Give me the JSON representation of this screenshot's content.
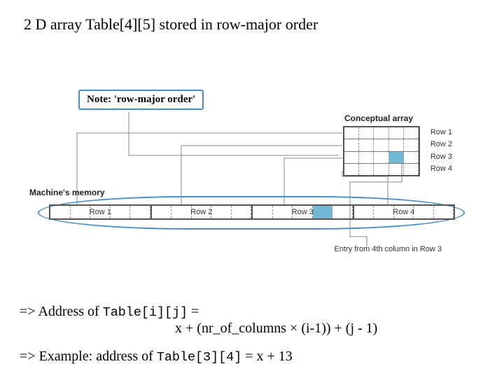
{
  "title": "2 D array Table[4][5] stored in row-major order",
  "note_prefix": "Note: ",
  "note_term": "'row-major order'",
  "labels": {
    "conceptual": "Conceptual array",
    "machine": "Machine's memory",
    "entry": "Entry from 4th column in Row 3"
  },
  "conceptual_rows": [
    "Row 1",
    "Row 2",
    "Row 3",
    "Row 4"
  ],
  "memory_rows": [
    "Row 1",
    "Row 2",
    "Row 3",
    "Row 4"
  ],
  "formula": {
    "arrow": "=> ",
    "addr_of": "Address of ",
    "code1": "Table[i][j]",
    "eq": " =",
    "rhs": "x + (nr_of_columns × (i-1)) + (j - 1)",
    "ex_prefix": "Example: address of ",
    "code2": "Table[3][4]",
    "ex_suffix": " =  x + 13"
  }
}
